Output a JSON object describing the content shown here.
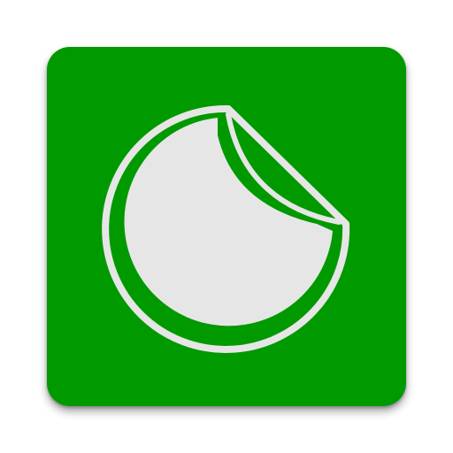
{
  "app_icon": {
    "icon": "sticker-peel-icon",
    "colors": {
      "tile_background": "#019900",
      "sticker_fill": "#e6e6e6",
      "sticker_outline": "#e6e6e6",
      "peel_shadow": "#019900"
    }
  }
}
